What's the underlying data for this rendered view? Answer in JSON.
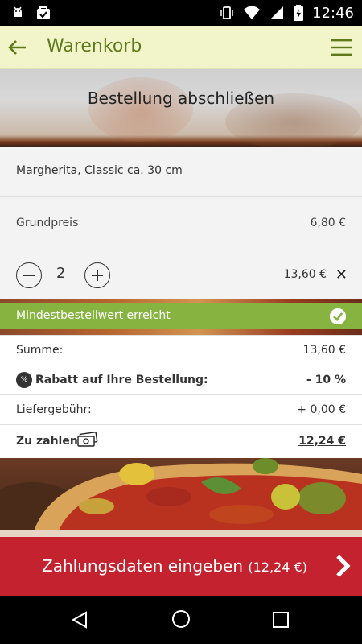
{
  "status_bar": {
    "time": "12:46"
  },
  "app_bar": {
    "title": "Warenkorb"
  },
  "hero": {
    "heading": "Bestellung abschließen"
  },
  "cart_item": {
    "name": "Margherita, Classic ca. 30 cm",
    "base_price_label": "Grundpreis",
    "base_price": "6,80 €",
    "quantity": "2",
    "line_total": "13,60 €",
    "remove_symbol": "✕"
  },
  "minimum_order": {
    "text": "Mindestbestellwert erreicht"
  },
  "summary": {
    "sum_label": "Summe:",
    "sum_value": "13,60 €",
    "discount_label": "Rabatt auf Ihre Bestellung:",
    "discount_value": "- 10 %",
    "discount_badge": "%",
    "delivery_label": "Liefergebühr:",
    "delivery_value": "+ 0,00 €",
    "total_label": "Zu zahlen",
    "total_value": "12,24 €"
  },
  "cta": {
    "label": "Zahlungsdaten eingeben",
    "amount": "(12,24 €)"
  },
  "colors": {
    "accent_green": "#87b441",
    "appbar_bg": "#f1f5c9",
    "title_green": "#5f7a1a",
    "cta_red": "#c4222e"
  }
}
